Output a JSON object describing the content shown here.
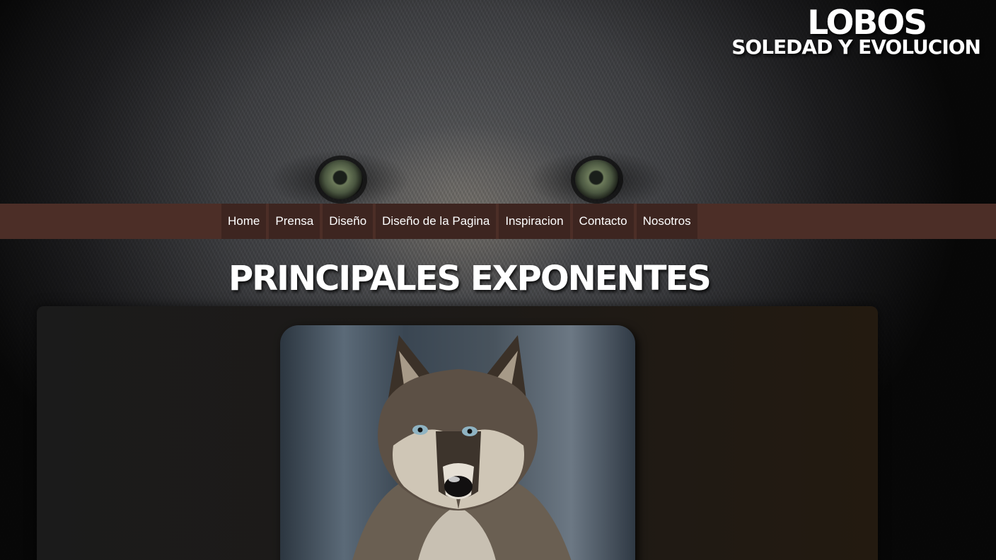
{
  "header": {
    "logo_title": "LOBOS",
    "logo_subtitle": "SOLEDAD Y EVOLUCION"
  },
  "nav": {
    "items": [
      {
        "label": "Home"
      },
      {
        "label": "Prensa"
      },
      {
        "label": "Diseño"
      },
      {
        "label": "Diseño de la Pagina"
      },
      {
        "label": "Inspiracion"
      },
      {
        "label": "Contacto"
      },
      {
        "label": "Nosotros"
      }
    ]
  },
  "main": {
    "section_title": "PRINCIPALES EXPONENTES"
  },
  "colors": {
    "nav_bar": "#4c2e27",
    "nav_item": "#3d2520",
    "panel": "#1b1b1b",
    "text": "#ffffff"
  }
}
